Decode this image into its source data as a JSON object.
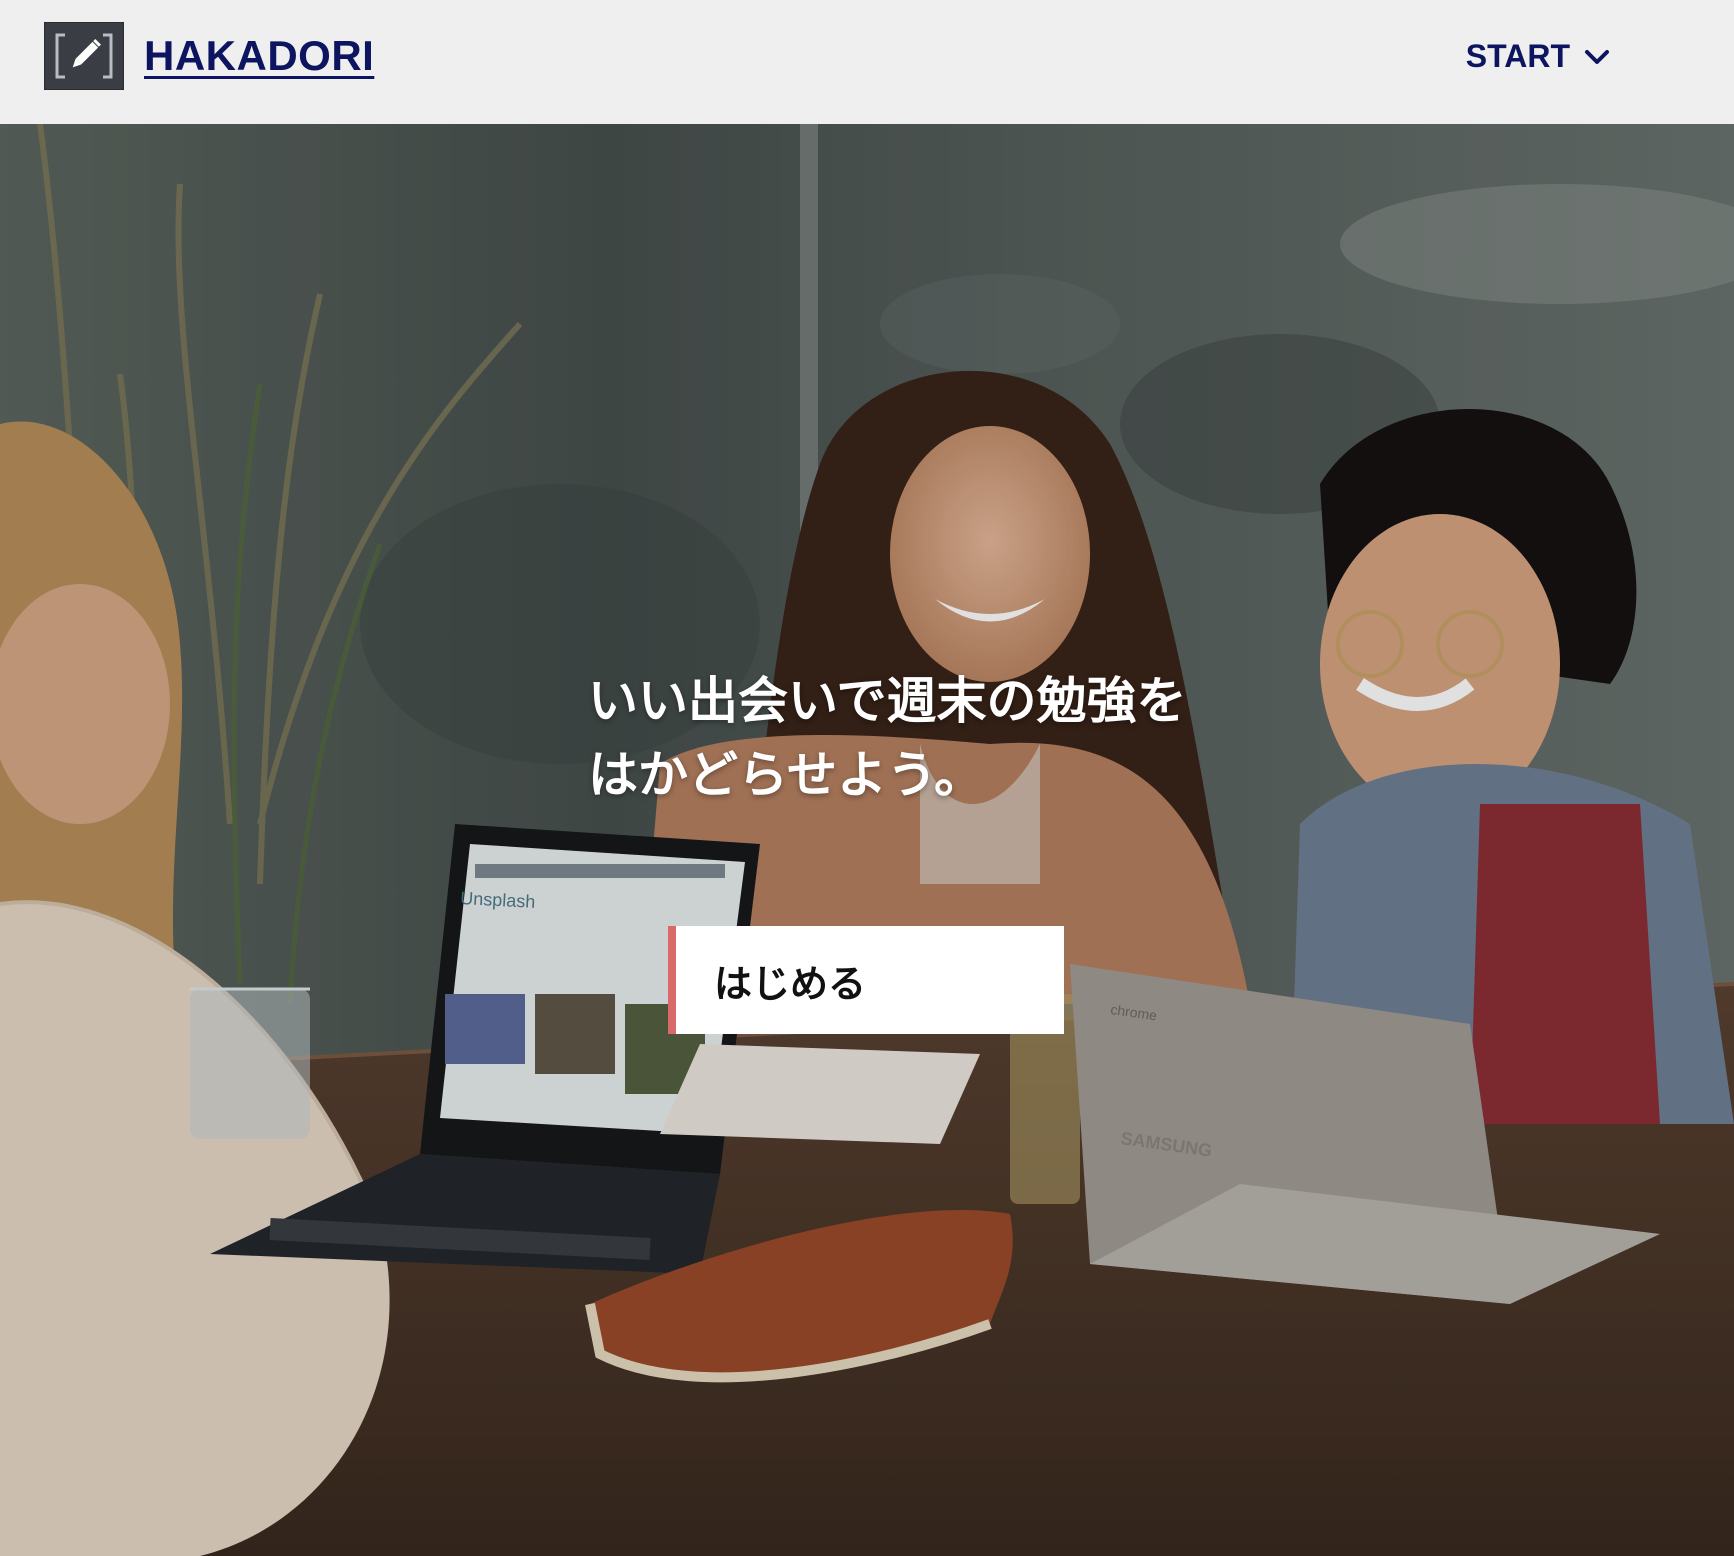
{
  "header": {
    "logo_text": "HAKADORI",
    "nav_start_label": "START",
    "colors": {
      "brand": "#0d1460",
      "logo_bg": "#3a3d44"
    }
  },
  "hero": {
    "headline_line1": "いい出会いで週末の勉強を",
    "headline_line2": "はかどらせよう。",
    "cta_label": "はじめる",
    "cta_accent": "#d96a6a"
  }
}
